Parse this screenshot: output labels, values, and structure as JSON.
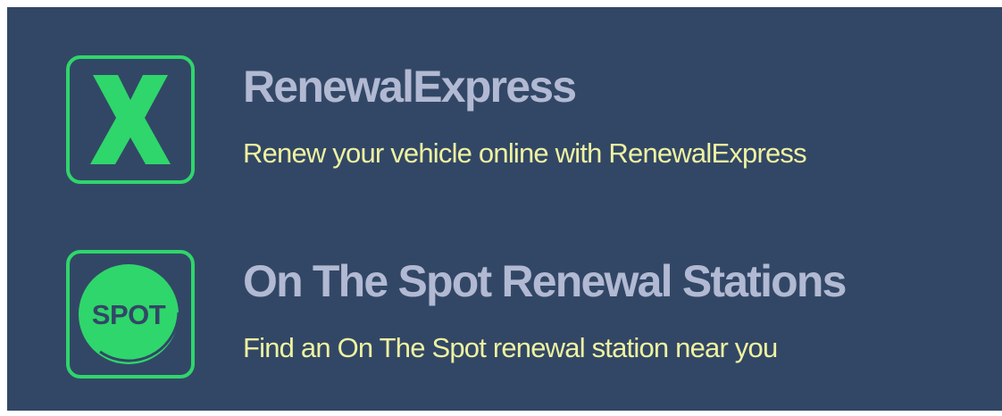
{
  "links": [
    {
      "title": "RenewalExpress",
      "description": "Renew your vehicle online with RenewalExpress",
      "icon": "renewal-express-x-icon",
      "icon_text": "X"
    },
    {
      "title": "On The Spot Renewal Stations",
      "description": "Find an On The Spot renewal station near you",
      "icon": "spot-badge-icon",
      "icon_text": "SPOT"
    }
  ],
  "colors": {
    "background": "#324766",
    "accent_green": "#2fd66b",
    "title": "#b2b9d2",
    "description": "#eef2a0"
  }
}
